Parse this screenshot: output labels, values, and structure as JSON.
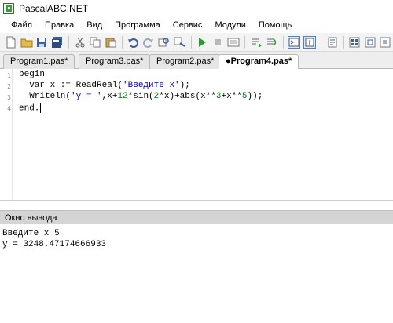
{
  "window": {
    "title": "PascalABC.NET"
  },
  "menu": {
    "items": [
      "Файл",
      "Правка",
      "Вид",
      "Программа",
      "Сервис",
      "Модули",
      "Помощь"
    ]
  },
  "toolbar": {
    "icons": [
      "new-file-icon",
      "open-folder-icon",
      "save-icon",
      "save-all-icon",
      "cut-icon",
      "copy-icon",
      "paste-icon",
      "undo-icon",
      "redo-icon",
      "find-icon",
      "replace-icon",
      "run-icon",
      "stop-icon",
      "compile-icon",
      "debug-step-icon",
      "step-over-icon",
      "console-toggle-icon",
      "output-toggle-icon",
      "format-icon",
      "form-designer-icon",
      "units-icon",
      "help-icon"
    ]
  },
  "tabs": [
    {
      "label": "Program1.pas*",
      "active": false
    },
    {
      "label": "Program3.pas*",
      "active": false
    },
    {
      "label": "Program2.pas*",
      "active": false
    },
    {
      "label": "●Program4.pas*",
      "active": true
    }
  ],
  "editor": {
    "line_numbers": [
      "1",
      "2",
      "3",
      "4"
    ],
    "lines": {
      "l1": "begin",
      "l2a": "  var x := ReadReal(",
      "l2b": "'Введите x'",
      "l2c": ");",
      "l3a": "  Writeln(",
      "l3b": "'y = '",
      "l3c": ",x+",
      "l3d": "12",
      "l3e": "*sin(",
      "l3f": "2",
      "l3g": "*x)+abs(x**",
      "l3h": "3",
      "l3i": "+x**",
      "l3j": "5",
      "l3k": "));",
      "l4": "end."
    }
  },
  "output": {
    "header": "Окно вывода",
    "lines": [
      "Введите x 5",
      "y = 3248.47174666933"
    ]
  },
  "colors": {
    "string": "#0000cc",
    "number": "#008000",
    "toolbar_bg": "#f3f3f3",
    "output_header_bg": "#d4d4d4"
  }
}
